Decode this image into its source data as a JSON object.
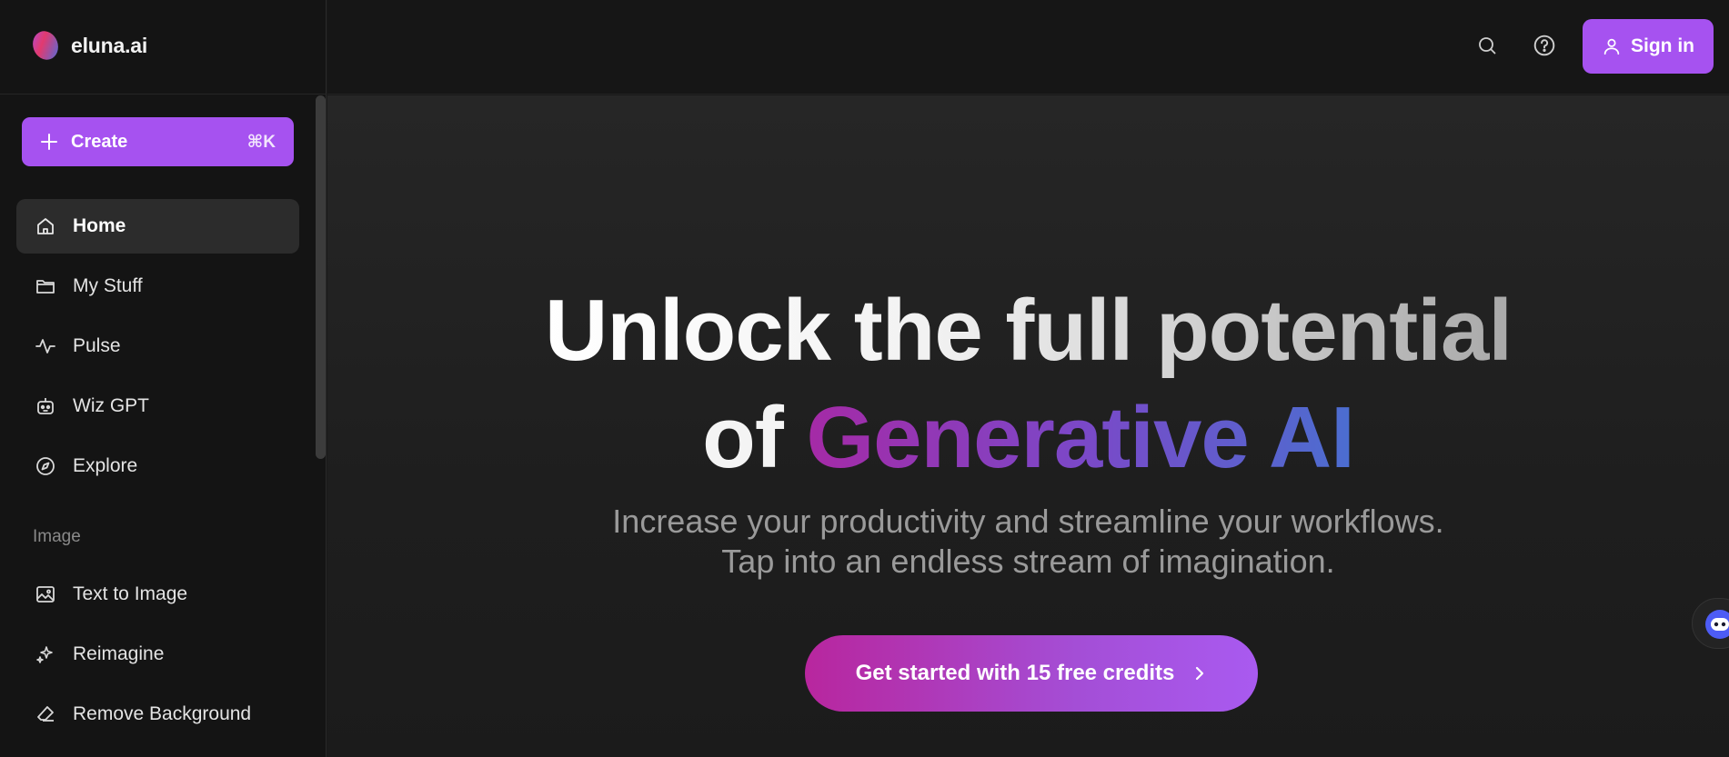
{
  "brand": {
    "name": "eluna.ai"
  },
  "sidebar": {
    "create": {
      "label": "Create",
      "shortcut": "⌘K"
    },
    "items": [
      {
        "label": "Home",
        "icon": "home-icon",
        "active": true
      },
      {
        "label": "My Stuff",
        "icon": "folder-icon"
      },
      {
        "label": "Pulse",
        "icon": "pulse-icon"
      },
      {
        "label": "Wiz GPT",
        "icon": "robot-icon"
      },
      {
        "label": "Explore",
        "icon": "compass-icon"
      }
    ],
    "section_image": "Image",
    "image_items": [
      {
        "label": "Text to Image",
        "icon": "image-icon"
      },
      {
        "label": "Reimagine",
        "icon": "sparkles-icon"
      },
      {
        "label": "Remove Background",
        "icon": "eraser-icon"
      }
    ]
  },
  "header": {
    "sign_in": "Sign in",
    "icons": [
      "search-icon",
      "help-icon",
      "user-icon"
    ]
  },
  "hero": {
    "title_line1": "Unlock the full potential",
    "title_line2_prefix": "of",
    "title_line2_highlight": "Generative AI",
    "subtitle_line1": "Increase your productivity and streamline your workflows.",
    "subtitle_line2": "Tap into an endless stream of imagination.",
    "cta": "Get started with 15 free credits"
  },
  "colors": {
    "accent": "#a652f0",
    "background": "#191919",
    "sidebar": "#141414",
    "gradient_start": "#a52aa6",
    "gradient_end": "#4b6ed0"
  }
}
